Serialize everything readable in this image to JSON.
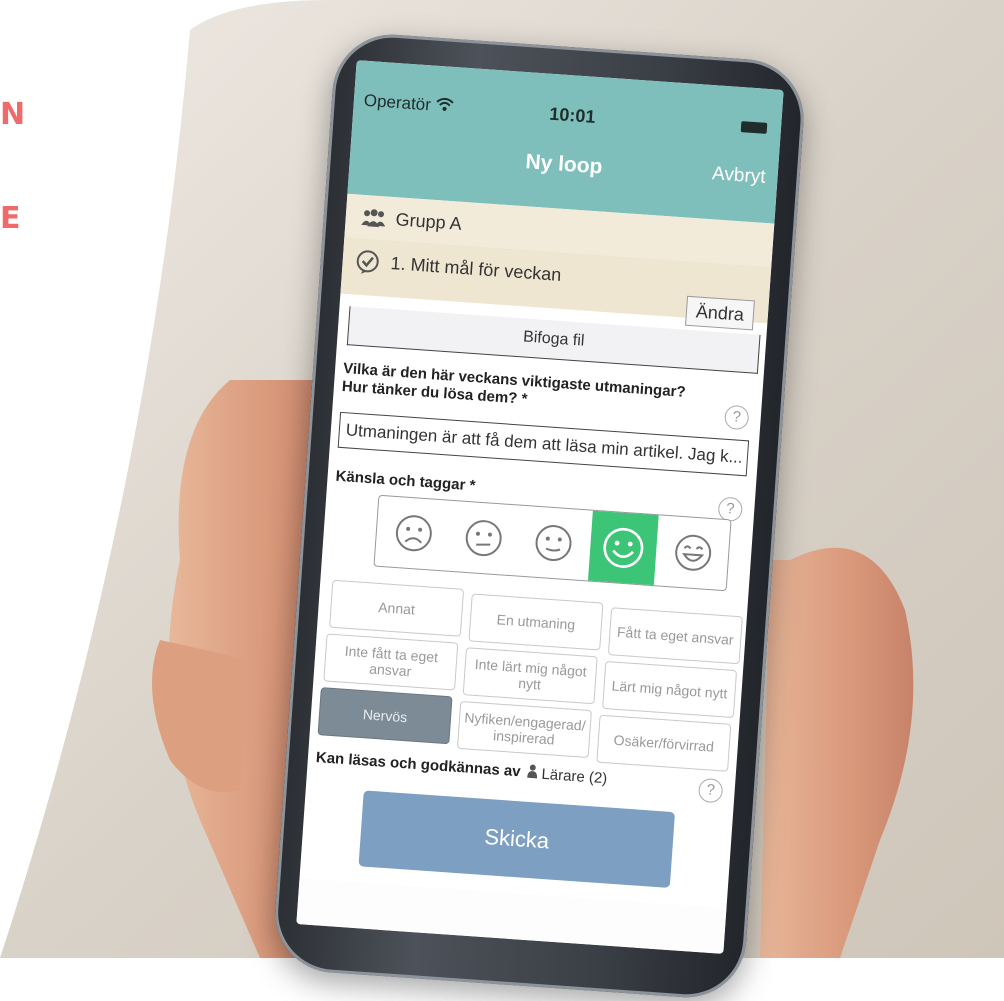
{
  "background": {
    "edge_letters": [
      "N",
      "E"
    ],
    "accent_color": "#ef6a6a"
  },
  "status_bar": {
    "operator": "Operatör",
    "time": "10:01"
  },
  "nav": {
    "title": "Ny loop",
    "cancel_label": "Avbryt"
  },
  "group": {
    "name": "Grupp A"
  },
  "goal": {
    "label": "1. Mitt mål för veckan",
    "edit_label": "Ändra"
  },
  "attach": {
    "label": "Bifoga fil"
  },
  "question": {
    "line1": "Vilka är den här veckans viktigaste utmaningar?",
    "line2": "Hur tänker du lösa dem? *",
    "answer": "Utmaningen är att få dem att läsa min artikel. Jag k...",
    "help": "?"
  },
  "feelings": {
    "label": "Känsla och taggar *",
    "help": "?",
    "moods": [
      "very-sad-face-icon",
      "neutral-face-icon",
      "slightly-smiling-face-icon",
      "smiling-face-icon",
      "laughing-face-icon"
    ],
    "selected_mood_index": 3,
    "selected_color": "#3cc477"
  },
  "tags": [
    {
      "label": "Annat",
      "active": false
    },
    {
      "label": "En utmaning",
      "active": false
    },
    {
      "label": "Fått ta eget ansvar",
      "active": false
    },
    {
      "label": "Inte fått ta eget ansvar",
      "active": false
    },
    {
      "label": "Inte lärt mig något nytt",
      "active": false
    },
    {
      "label": "Lärt mig något nytt",
      "active": false
    },
    {
      "label": "Nervös",
      "active": true
    },
    {
      "label": "Nyfiken/engagerad/ inspirerad",
      "active": false
    },
    {
      "label": "Osäker/förvirrad",
      "active": false
    }
  ],
  "readers": {
    "label": "Kan läsas och godkännas av",
    "value": "Lärare (2)",
    "help": "?"
  },
  "send": {
    "label": "Skicka"
  },
  "colors": {
    "header": "#7fbfbb",
    "group_row": "#f3ebd9",
    "send_button": "#7d9fc2",
    "active_tag": "#7d8b96"
  }
}
